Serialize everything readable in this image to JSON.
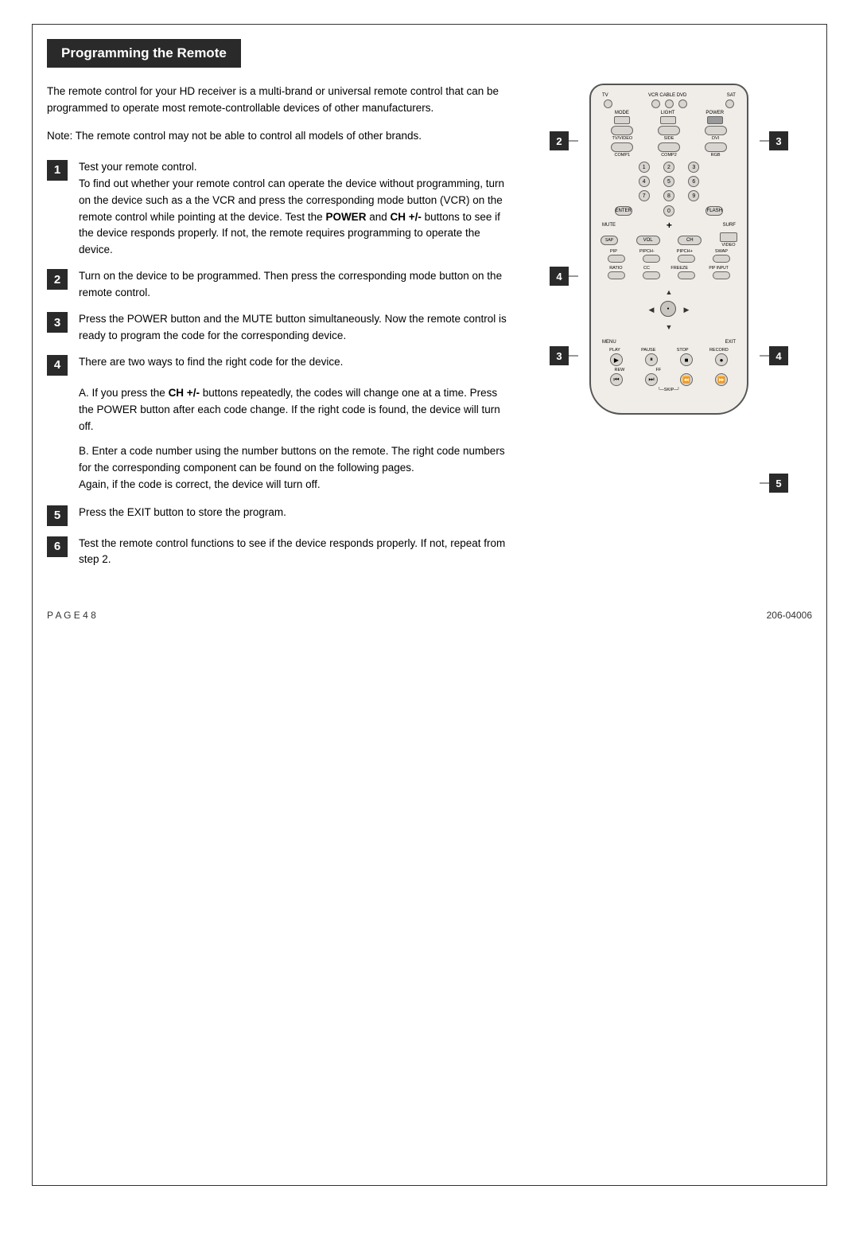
{
  "header": {
    "title": "Programming the Remote"
  },
  "intro": {
    "paragraph1": "The remote control for your HD receiver is a multi-brand or universal remote control that can be programmed to operate most remote-controllable devices of other manufacturers.",
    "paragraph2": "Note: The remote control may not be able to control all models of other brands."
  },
  "steps": [
    {
      "num": "1",
      "text": "Test your remote control.\nTo find out whether your remote control can operate the device without programming, turn on the device such as a the VCR and press the corresponding mode button (VCR) on the remote control while pointing at the device. Test the POWER and CH +/- buttons to see if the device responds properly. If not, the remote requires programming to operate the device."
    },
    {
      "num": "2",
      "text": "Turn on the device to be programmed. Then press the corresponding mode button on the remote control."
    },
    {
      "num": "3",
      "text": "Press the POWER button and the MUTE button simultaneously. Now the remote control is ready to program the code for the corresponding device."
    },
    {
      "num": "4",
      "text": "There are two ways to find the right code for the device.\n\nA. If you press the CH +/- buttons repeatedly, the codes will change one at a time. Press the POWER button after each code change. If the right code is found, the device will turn off.\n\nB. Enter a code number using the number buttons on the remote. The right code numbers for the corresponding component can be found on the following pages.\nAgain, if the code is correct, the device will turn off."
    },
    {
      "num": "5",
      "text": "Press the EXIT button to store the program."
    },
    {
      "num": "6",
      "text": "Test the remote control functions to see if the device responds properly. If not, repeat from step 2."
    }
  ],
  "callouts": {
    "left2": "2",
    "left4": "4",
    "left3": "3",
    "right3": "3",
    "right4": "4",
    "right5": "5"
  },
  "footer": {
    "left": "P A G E   4 8",
    "right": "206-04006"
  },
  "remote": {
    "mode_buttons": [
      "TV",
      "VCR",
      "CABLE",
      "DVD",
      "SAT"
    ],
    "function_labels": [
      "MODE",
      "LIGHT",
      "POWER"
    ],
    "source_labels": [
      "TV/VIDEO",
      "SIDE",
      "DVI"
    ],
    "source2_labels": [
      "COMP1",
      "COMP2",
      "RGB"
    ],
    "numbers": [
      "1",
      "2",
      "3",
      "4",
      "5",
      "6",
      "7",
      "8",
      "9",
      "ENTER",
      "0",
      "FLASH"
    ],
    "vol_labels": [
      "MUTE",
      "",
      "SURF",
      "SAP",
      "VOL",
      "CH",
      "VIDEO"
    ],
    "pip_labels": [
      "PIP",
      "PIPCH-",
      "PIPCH+",
      "SWAP"
    ],
    "fn_labels": [
      "RATIO",
      "CC",
      "FREEZE",
      "PIP INPUT"
    ],
    "nav_labels": [
      "MENU",
      "EXIT"
    ],
    "transport_labels": [
      "PLAY",
      "PAUSE",
      "STOP",
      "RECORD"
    ],
    "rew_labels": [
      "REW",
      "FF",
      "",
      "",
      "SKIP"
    ]
  }
}
